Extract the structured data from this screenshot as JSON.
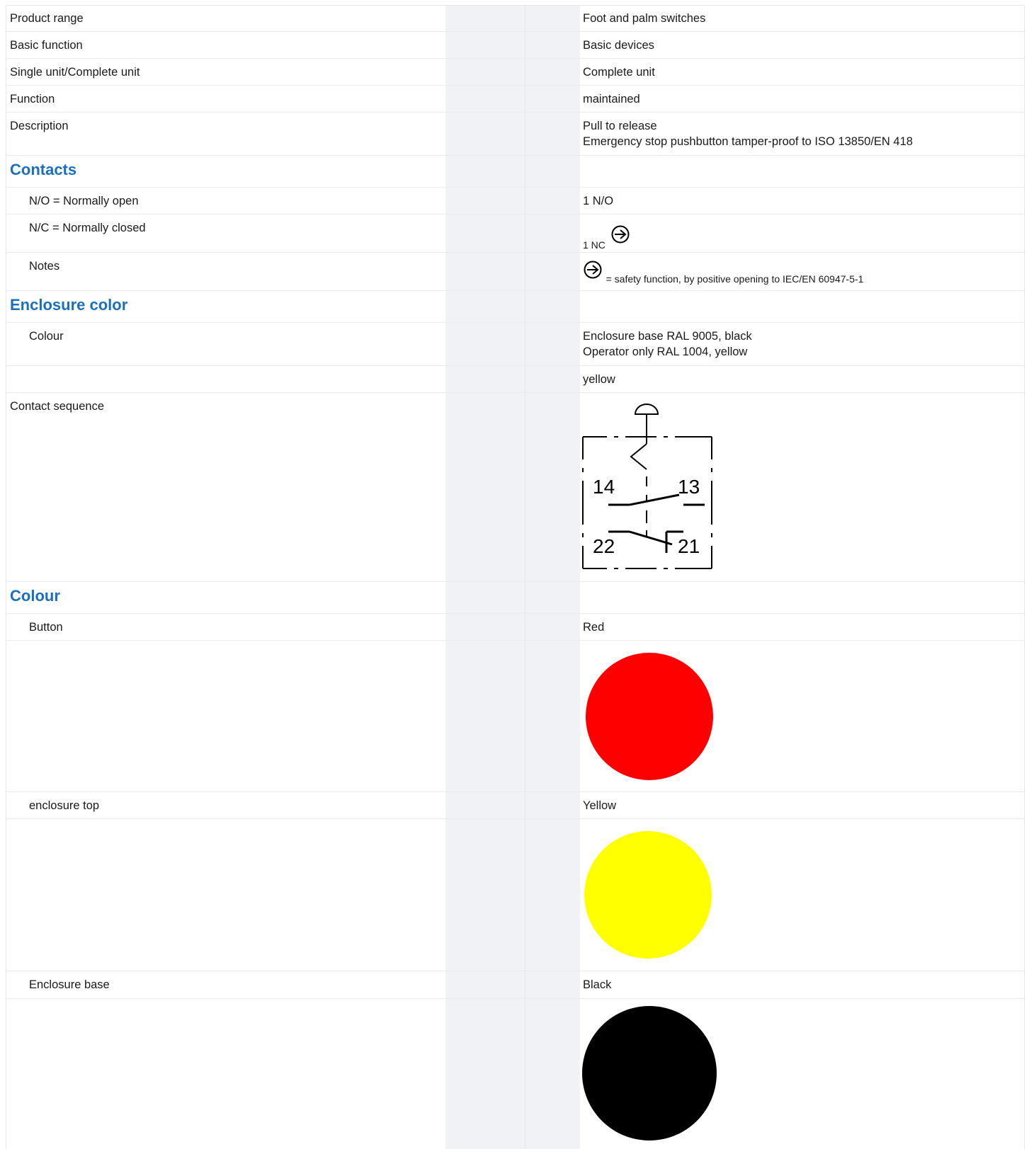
{
  "rows": {
    "product_range": {
      "label": "Product range",
      "value": "Foot and palm switches"
    },
    "basic_function": {
      "label": "Basic function",
      "value": "Basic devices"
    },
    "single_complete": {
      "label": "Single unit/Complete unit",
      "value": "Complete unit"
    },
    "function": {
      "label": "Function",
      "value": "maintained"
    },
    "description": {
      "label": "Description",
      "value_line1": "Pull to release",
      "value_line2": "Emergency stop pushbutton tamper-proof to ISO 13850/EN 418"
    }
  },
  "contacts": {
    "heading": "Contacts",
    "no": {
      "label": "N/O = Normally open",
      "value": "1 N/O"
    },
    "nc": {
      "label": "N/C = Normally closed",
      "value": "1 NC"
    },
    "notes": {
      "label": "Notes",
      "value": "= safety function, by positive opening to IEC/EN 60947-5-1"
    }
  },
  "enclosure_color": {
    "heading": "Enclosure color",
    "colour": {
      "label": "Colour",
      "value_line1": "Enclosure base RAL 9005, black",
      "value_line2": "Operator only RAL 1004, yellow"
    },
    "extra_value": "yellow"
  },
  "contact_sequence": {
    "label": "Contact sequence",
    "terminals": {
      "t14": "14",
      "t13": "13",
      "t22": "22",
      "t21": "21"
    }
  },
  "colour": {
    "heading": "Colour",
    "button": {
      "label": "Button",
      "value": "Red",
      "swatch": "#ff0000"
    },
    "enclosure_top": {
      "label": "enclosure top",
      "value": "Yellow",
      "swatch": "#ffff00"
    },
    "enclosure_base": {
      "label": "Enclosure base",
      "value": "Black",
      "swatch": "#000000"
    }
  },
  "colors": {
    "heading_blue": "#1b6fbd",
    "band": "#f1f2f6"
  }
}
